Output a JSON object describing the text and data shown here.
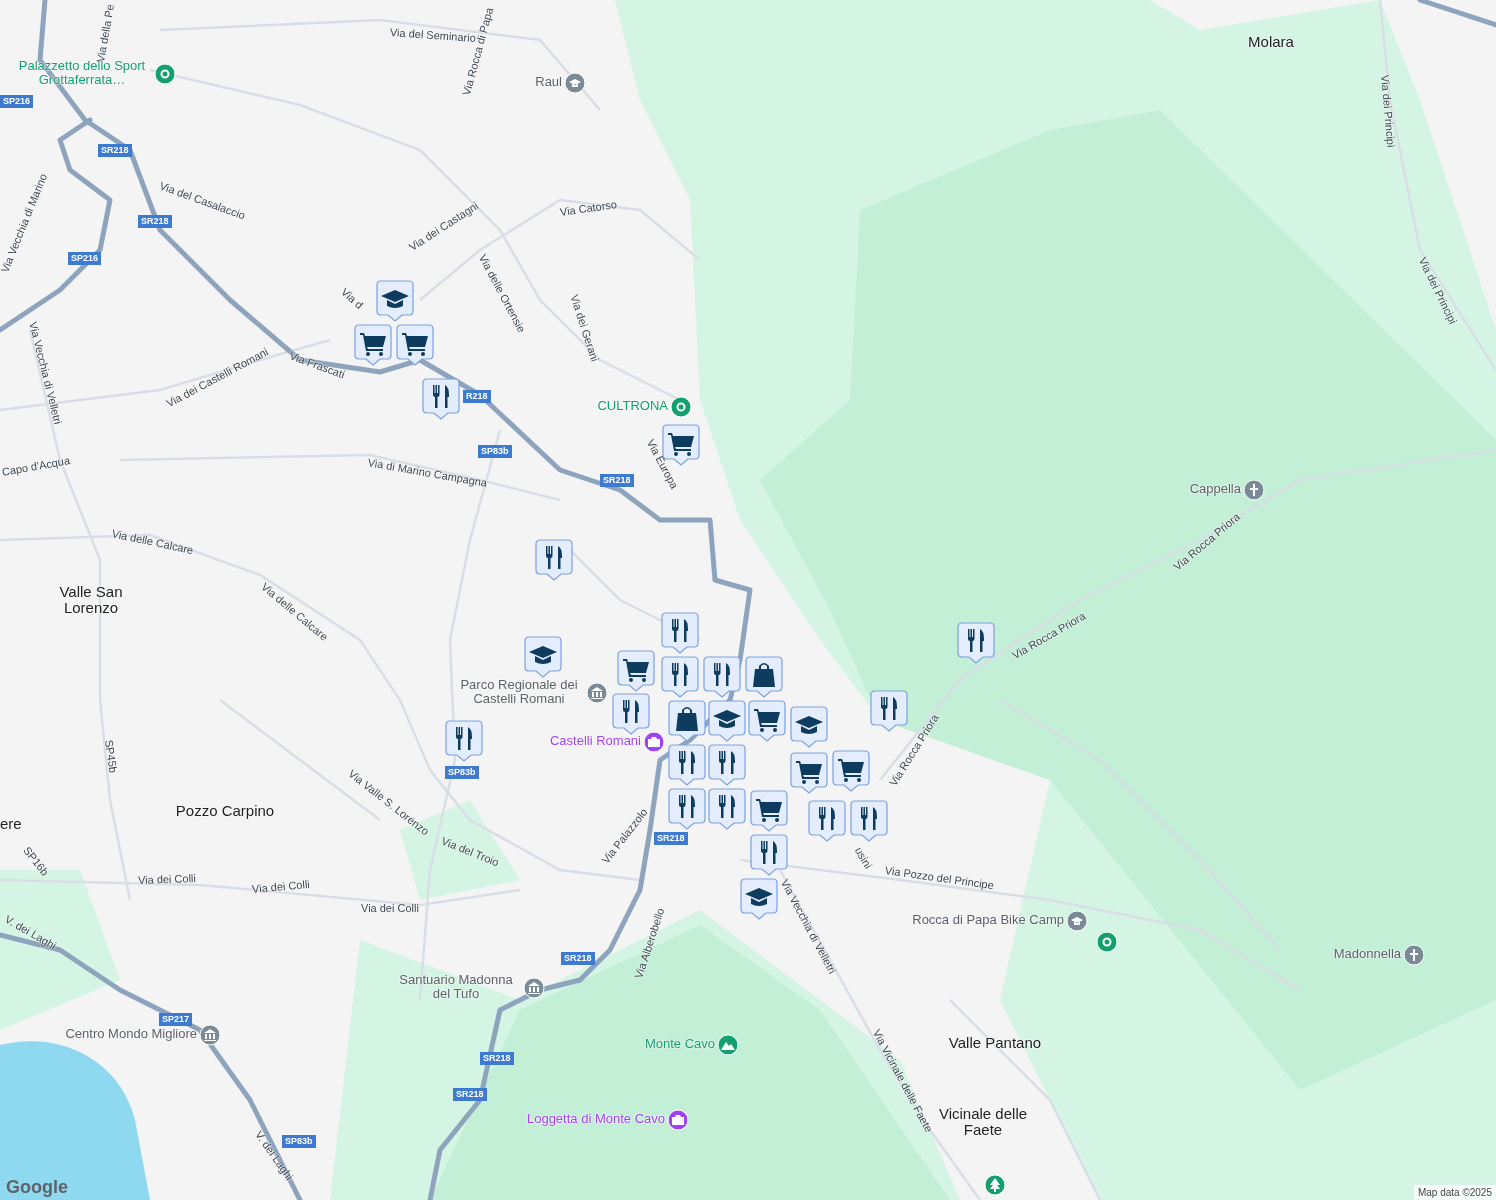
{
  "map": {
    "area_labels": [
      {
        "text": "Molara"
      },
      {
        "text": "Valle San Lorenzo"
      },
      {
        "text": "Pozzo Carpino"
      },
      {
        "text": "ere"
      },
      {
        "text": "Valle Pantano"
      },
      {
        "text": "Vicinale delle Faete"
      }
    ],
    "places": [
      {
        "name": "Palazzetto dello Sport Grottaferrata…",
        "kind": "pin",
        "color": "#12a06e"
      },
      {
        "name": "Raul",
        "kind": "school",
        "color": "#7b8a97"
      },
      {
        "name": "CULTRONA",
        "kind": "pin",
        "color": "#12a06e"
      },
      {
        "name": "Cappella",
        "kind": "cross",
        "color": "#7b8a97"
      },
      {
        "name": "Parco Regionale dei Castelli Romani",
        "kind": "museum",
        "color": "#7b8a97"
      },
      {
        "name": "Castelli Romani",
        "kind": "camera",
        "color": "#a142f4"
      },
      {
        "name": "Rocca di Papa Bike Camp",
        "kind": "school",
        "color": "#7b8a97"
      },
      {
        "kind": "pin",
        "color": "#12a06e"
      },
      {
        "name": "Madonnella",
        "kind": "cross",
        "color": "#7b8a97"
      },
      {
        "name": "Santuario Madonna del Tufo",
        "kind": "museum",
        "color": "#7b8a97"
      },
      {
        "name": "Centro Mondo Migliore",
        "kind": "museum",
        "color": "#7b8a97"
      },
      {
        "name": "Monte Cavo",
        "kind": "mountain",
        "color": "#12a06e"
      },
      {
        "name": "Loggetta di Monte Cavo",
        "kind": "camera",
        "color": "#a142f4"
      },
      {
        "kind": "tree",
        "color": "#12a06e"
      }
    ],
    "street_labels": [
      {
        "text": "Via della Pe"
      },
      {
        "text": "Via del Seminario"
      },
      {
        "text": "Via Rocca di Papa"
      },
      {
        "text": "Via del Casalaccio"
      },
      {
        "text": "Via Catorso"
      },
      {
        "text": "Via dei Castagni"
      },
      {
        "text": "Via delle Ortensie"
      },
      {
        "text": "Via dei Gerani"
      },
      {
        "text": "Via Vecchia di Marino"
      },
      {
        "text": "Via Vecchia di Velletri"
      },
      {
        "text": "Via d"
      },
      {
        "text": "Via dei Castelli Romani"
      },
      {
        "text": "Via Frascati"
      },
      {
        "text": "Capo d'Acqua"
      },
      {
        "text": "Via di Marino Campagna"
      },
      {
        "text": "Via Europa"
      },
      {
        "text": "Via delle Calcare"
      },
      {
        "text": "Via delle Calcare"
      },
      {
        "text": "SP45b"
      },
      {
        "text": "SP16b"
      },
      {
        "text": "Via Valle S. Lorenzo"
      },
      {
        "text": "Via del Troio"
      },
      {
        "text": "Via Palazzolo"
      },
      {
        "text": "Via dei Colli"
      },
      {
        "text": "Via dei Colli"
      },
      {
        "text": "Via dei Colli"
      },
      {
        "text": "V. dei Laghi"
      },
      {
        "text": "V. dei Laghi"
      },
      {
        "text": "Via Alberobello"
      },
      {
        "text": "Via Vecchia di Velletri"
      },
      {
        "text": "usini"
      },
      {
        "text": "Via Pozzo del Principe"
      },
      {
        "text": "Via Vicinale delle Faete"
      },
      {
        "text": "Via Rocca Priora"
      },
      {
        "text": "Via Rocca Priora"
      },
      {
        "text": "Via Rocca Priora"
      },
      {
        "text": "Via dei Principi"
      },
      {
        "text": "Via dei Principi"
      }
    ],
    "road_shields": [
      {
        "text": "SP216"
      },
      {
        "text": "SR218"
      },
      {
        "text": "SR218"
      },
      {
        "text": "SP216"
      },
      {
        "text": "R218"
      },
      {
        "text": "SP83b"
      },
      {
        "text": "SR218"
      },
      {
        "text": "SP83b"
      },
      {
        "text": "SR218"
      },
      {
        "text": "SR218"
      },
      {
        "text": "SP217"
      },
      {
        "text": "SR218"
      },
      {
        "text": "SR218"
      },
      {
        "text": "SP83b"
      }
    ],
    "markers": [
      {
        "kind": "school"
      },
      {
        "kind": "cart"
      },
      {
        "kind": "cart"
      },
      {
        "kind": "restaurant"
      },
      {
        "kind": "cart"
      },
      {
        "kind": "restaurant"
      },
      {
        "kind": "restaurant"
      },
      {
        "kind": "school"
      },
      {
        "kind": "restaurant"
      },
      {
        "kind": "restaurant"
      },
      {
        "kind": "bag"
      },
      {
        "kind": "restaurant"
      },
      {
        "kind": "restaurant"
      },
      {
        "kind": "restaurant"
      },
      {
        "kind": "cart"
      },
      {
        "kind": "restaurant"
      },
      {
        "kind": "bag"
      },
      {
        "kind": "school"
      },
      {
        "kind": "cart"
      },
      {
        "kind": "school"
      },
      {
        "kind": "cart"
      },
      {
        "kind": "cart"
      },
      {
        "kind": "restaurant"
      },
      {
        "kind": "restaurant"
      },
      {
        "kind": "restaurant"
      },
      {
        "kind": "restaurant"
      },
      {
        "kind": "cart"
      },
      {
        "kind": "restaurant"
      },
      {
        "kind": "restaurant"
      },
      {
        "kind": "restaurant"
      },
      {
        "kind": "school"
      }
    ],
    "logo": "Google",
    "attribution": "Map data ©2025"
  }
}
